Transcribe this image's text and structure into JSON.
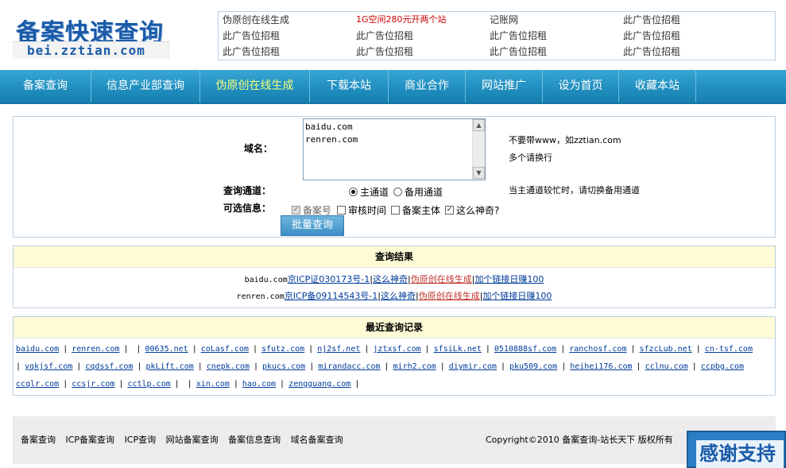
{
  "logo": {
    "title": "备案快速查询",
    "url": "bei.zztian.com"
  },
  "ads": [
    [
      "伪原创在线生成",
      "1G空间280元开两个站",
      "记账网",
      "此广告位招租"
    ],
    [
      "此广告位招租",
      "此广告位招租",
      "此广告位招租",
      "此广告位招租"
    ],
    [
      "此广告位招租",
      "此广告位招租",
      "此广告位招租",
      "此广告位招租"
    ]
  ],
  "nav": [
    "备案查询",
    "信息产业部查询",
    "伪原创在线生成",
    "下载本站",
    "商业合作",
    "网站推广",
    "设为首页",
    "收藏本站"
  ],
  "query": {
    "domain_label": "域名：",
    "domain_value": "baidu.com\nrenren.com",
    "hint1": "不要带www，如zztian.com",
    "hint2": "多个请换行",
    "channel_label": "查询通道：",
    "channel_main": "主通道",
    "channel_backup": "备用通道",
    "channel_hint": "当主通道较忙时，请切换备用通道",
    "optional_label": "可选信息：",
    "options": [
      "备案号",
      "审核时间",
      "备案主体",
      "这么神奇?"
    ],
    "submit": "批量查询"
  },
  "result": {
    "title": "查询结果",
    "rows": [
      {
        "domain": "baidu.com",
        "icp": "京ICP证030173号-1",
        "l1": "这么神奇",
        "l2": "伪原创在线生成",
        "l3": "加个链接日赚100"
      },
      {
        "domain": "renren.com",
        "icp": "京ICP备09114543号-1",
        "l1": "这么神奇",
        "l2": "伪原创在线生成",
        "l3": "加个链接日赚100"
      }
    ]
  },
  "records": {
    "title": "最近查询记录",
    "row1": [
      "baidu.com",
      "renren.com",
      "",
      "00635.net",
      "coLasf.com",
      "sfutz.com",
      "nj2sf.net",
      "jztxsf.com",
      "sfsiLk.net",
      "0510888sf.com",
      "ranchosf.com",
      "sfzcLub.net",
      "cn-tsf.com"
    ],
    "row2": [
      "yqkjsf.com",
      "cqdssf.com",
      "pkLift.com",
      "cnepk.com",
      "pkucs.com",
      "mirandacc.com",
      "mirh2.com",
      "diymir.com",
      "pku509.com",
      "heihei176.com",
      "cclnu.com",
      "ccpbg.com"
    ],
    "row3": [
      "ccqlr.com",
      "ccsjr.com",
      "cctlp.com",
      "",
      "xin.com",
      "hao.com",
      "zengguang.com"
    ]
  },
  "footer": {
    "links": [
      "备案查询",
      "ICP备案查询",
      "ICP查询",
      "网站备案查询",
      "备案信息查询",
      "域名备案查询"
    ],
    "copyright": "Copyright©2010 备案查询-站长天下 版权所有"
  },
  "thanks": "感谢支持"
}
